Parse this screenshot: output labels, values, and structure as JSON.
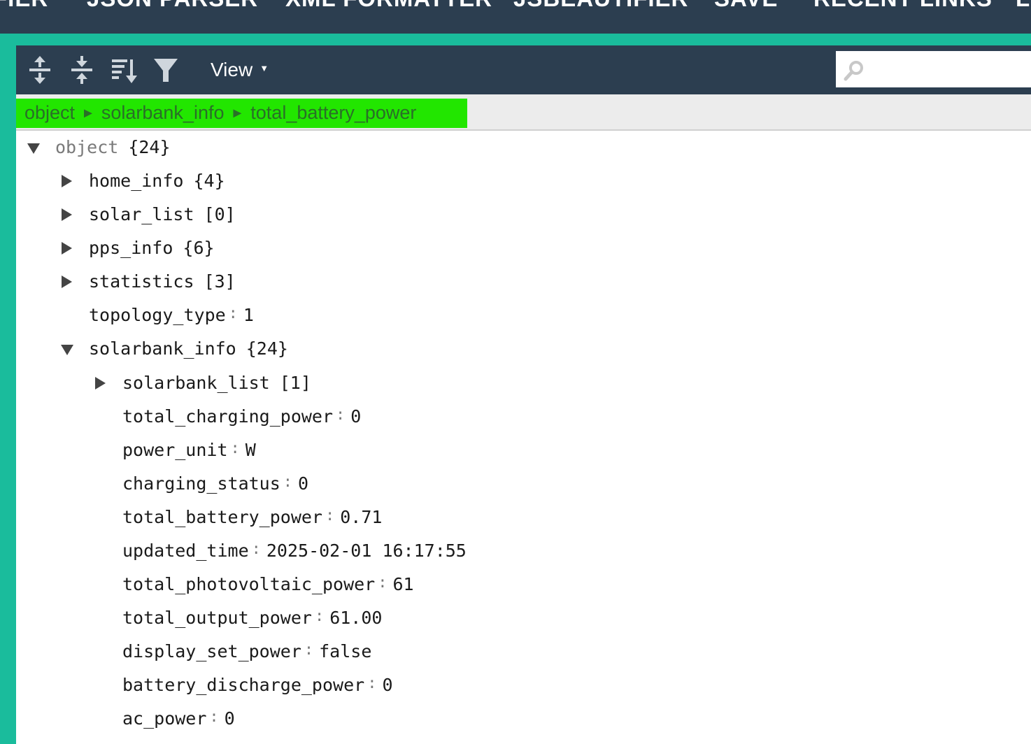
{
  "topnav": {
    "items": [
      "FIER",
      "JSON PARSER",
      "XML FORMATTER",
      "JSBEAUTIFIER",
      "SAVE",
      "RECENT LINKS",
      "L"
    ]
  },
  "toolbar": {
    "expand_all_icon": "expand-all-icon",
    "collapse_all_icon": "collapse-all-icon",
    "sort_icon": "sort-icon",
    "filter_icon": "filter-icon",
    "view_label": "View",
    "view_caret": "▼",
    "search_value": ""
  },
  "breadcrumb": {
    "items": [
      "object",
      "solarbank_info",
      "total_battery_power"
    ],
    "separator": "►",
    "highlight_color": "#22e600"
  },
  "tree": {
    "root": {
      "field": "object",
      "count": "{24}"
    },
    "nodes": [
      {
        "field": "home_info",
        "count": "{4}"
      },
      {
        "field": "solar_list",
        "count": "[0]"
      },
      {
        "field": "pps_info",
        "count": "{6}"
      },
      {
        "field": "statistics",
        "count": "[3]"
      },
      {
        "field": "topology_type",
        "value": "1"
      },
      {
        "field": "solarbank_info",
        "count": "{24}"
      }
    ],
    "children": [
      {
        "field": "solarbank_list",
        "count": "[1]"
      },
      {
        "field": "total_charging_power",
        "value": "0"
      },
      {
        "field": "power_unit",
        "value": "W"
      },
      {
        "field": "charging_status",
        "value": "0"
      },
      {
        "field": "total_battery_power",
        "value": "0.71"
      },
      {
        "field": "updated_time",
        "value": "2025-02-01 16:17:55"
      },
      {
        "field": "total_photovoltaic_power",
        "value": "61"
      },
      {
        "field": "total_output_power",
        "value": "61.00"
      },
      {
        "field": "display_set_power",
        "value": "false"
      },
      {
        "field": "battery_discharge_power",
        "value": "0"
      },
      {
        "field": "ac_power",
        "value": "0"
      }
    ]
  },
  "colors": {
    "nav_background": "#2c3e50",
    "accent": "#1abc9c",
    "breadcrumb_highlight": "#22e600"
  }
}
